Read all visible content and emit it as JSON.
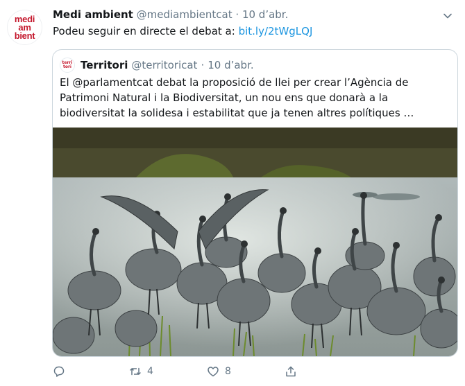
{
  "tweet": {
    "avatar_lines": [
      "medi",
      "am",
      "bient"
    ],
    "author_name": "Medi ambient",
    "author_handle": "@mediambientcat",
    "separator": "·",
    "date": "10 d’abr.",
    "text_prefix": "Podeu seguir en directe el debat a:",
    "link": "bit.ly/2tWgLQJ"
  },
  "quote": {
    "avatar_lines": [
      "terri",
      "tori"
    ],
    "author_name": "Territori",
    "author_handle": "@territoricat",
    "separator": "·",
    "date": "10 d’abr.",
    "text": "El @parlamentcat debat la proposició de llei per crear l’Agència de Patrimoni Natural i la Biodiversitat, un nou ens que donarà a la biodiversitat la solidesa i estabilitat que ja tenen altres polítiques …"
  },
  "actions": {
    "reply_count": "",
    "retweet_count": "4",
    "like_count": "8"
  },
  "colors": {
    "link": "#1b95e0",
    "muted": "#657786",
    "brand_red": "#c4172c",
    "border": "#ccd6dd"
  },
  "icons": [
    "chevron-down-icon",
    "reply-icon",
    "retweet-icon",
    "like-icon",
    "share-icon"
  ]
}
